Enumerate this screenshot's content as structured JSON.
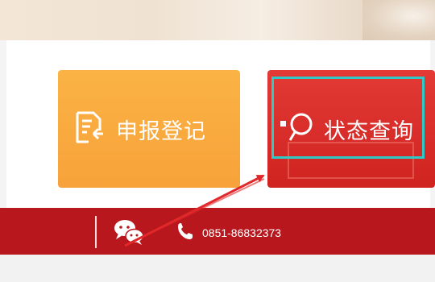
{
  "cards": {
    "register": {
      "label": "申报登记",
      "icon": "document-register-icon",
      "color": "#f7a23a"
    },
    "status": {
      "label": "状态查询",
      "icon": "search-icon",
      "color": "#d82b27"
    }
  },
  "footer": {
    "phone": "0851-86832373",
    "icons": [
      "wechat-icon",
      "phone-icon"
    ],
    "color": "#b8171d"
  },
  "annotations": {
    "highlight_color": "#2fc9c8",
    "arrow_color": "#e0282a"
  }
}
